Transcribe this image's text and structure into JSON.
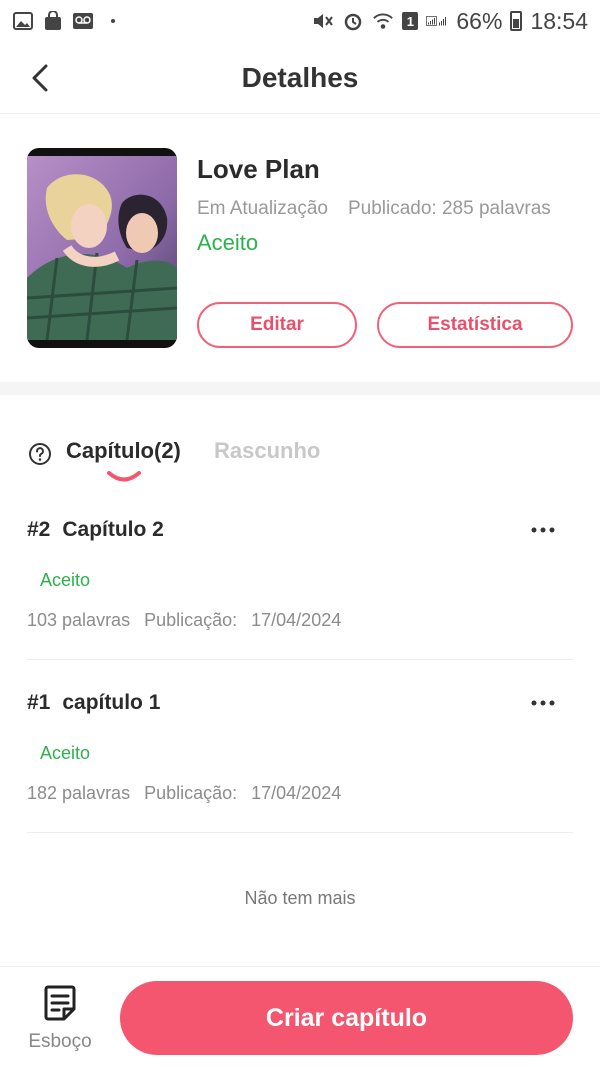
{
  "statusbar": {
    "battery_text": "66%",
    "time": "18:54",
    "notification_badge": "1",
    "icons": [
      "image-icon",
      "shopping-bag-icon",
      "voicemail-icon",
      "dot-icon",
      "mute-icon",
      "alarm-icon",
      "wifi-icon",
      "signal-icon",
      "battery-icon"
    ]
  },
  "header": {
    "title": "Detalhes",
    "back_icon": "chevron-left-icon"
  },
  "book": {
    "title": "Love Plan",
    "update_status": "Em Atualização",
    "published": "Publicado: 285 palavras",
    "review_status": "Aceito",
    "edit_label": "Editar",
    "stats_label": "Estatística"
  },
  "tabs": {
    "chapters_label": "Capítulo(2)",
    "draft_label": "Rascunho",
    "help_icon": "question-circle-icon"
  },
  "chapters": [
    {
      "number": "#2",
      "title": "Capítulo 2",
      "status": "Aceito",
      "words": "103 palavras",
      "pub_label": "Publicação:",
      "date": "17/04/2024"
    },
    {
      "number": "#1",
      "title": "capítulo 1",
      "status": "Aceito",
      "words": "182 palavras",
      "pub_label": "Publicação:",
      "date": "17/04/2024"
    }
  ],
  "list_end": "Não tem mais",
  "bottom": {
    "draft_label": "Esboço",
    "create_label": "Criar capítulo"
  },
  "colors": {
    "accent": "#f4566f",
    "accepted": "#2bb24c",
    "muted": "#999999"
  }
}
